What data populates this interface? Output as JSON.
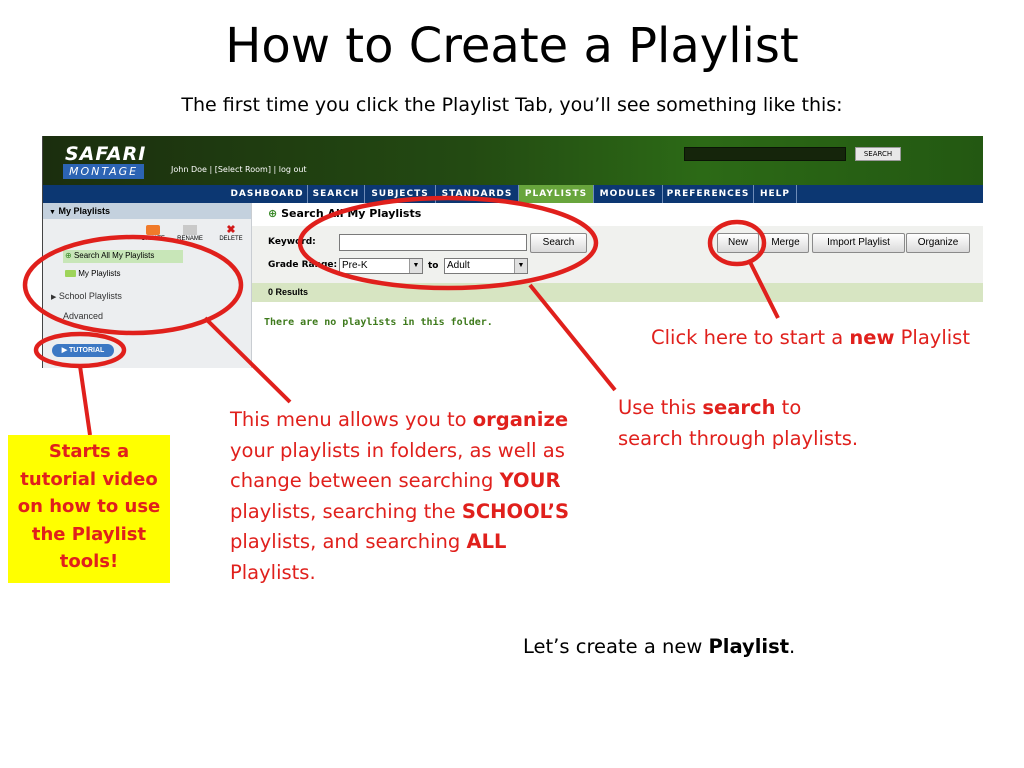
{
  "slide": {
    "title": "How to Create a Playlist",
    "subtitle": "The first time you click the Playlist Tab, you’ll see something like this:"
  },
  "app": {
    "logo_top": "SAFARI",
    "logo_bottom": "MONTAGE",
    "user_line": "John Doe | [Select Room] | log out",
    "global_search_button": "SEARCH",
    "nav": [
      {
        "label": "DASHBOARD",
        "active": false
      },
      {
        "label": "SEARCH",
        "active": false
      },
      {
        "label": "SUBJECTS",
        "active": false
      },
      {
        "label": "STANDARDS",
        "active": false
      },
      {
        "label": "PLAYLISTS",
        "active": true
      },
      {
        "label": "MODULES",
        "active": false
      },
      {
        "label": "PREFERENCES",
        "active": false
      },
      {
        "label": "HELP",
        "active": false
      }
    ],
    "sidebar": {
      "header": "My Playlists",
      "tools": [
        "CREATE",
        "RENAME",
        "DELETE"
      ],
      "tree": [
        "Search All My Playlists",
        "My Playlists"
      ],
      "sections": [
        "School Playlists",
        "Advanced"
      ],
      "tutorial_button": "TUTORIAL"
    },
    "main": {
      "title": "Search All My Playlists",
      "keyword_label": "Keyword:",
      "keyword_value": "",
      "search_button": "Search",
      "grade_label": "Grade Range:",
      "grade_from": "Pre-K",
      "grade_to_label": "to",
      "grade_to": "Adult",
      "buttons": [
        "New",
        "Merge",
        "Import Playlist",
        "Organize"
      ],
      "results_label": "0 Results",
      "empty_message": "There are no playlists in this folder."
    }
  },
  "annotations": {
    "new_note_pre": "Click here to start a ",
    "new_note_bold": "new",
    "new_note_post": " Playlist",
    "search_note_pre": "Use this ",
    "search_note_bold": "search",
    "search_note_post": " to",
    "search_note_line2": "search through playlists.",
    "menu_note": {
      "p1": "This menu allows you to ",
      "b1": "organize",
      "p2": "your playlists in folders, as well as change between searching ",
      "b2": "YOUR",
      "p3": "playlists, searching the ",
      "b3": "SCHOOL’S",
      "p4": "playlists, and searching ",
      "b4": "ALL",
      "p5": "Playlists."
    },
    "tutorial_note": "Starts a tutorial video on how to use the Playlist tools!",
    "closing_pre": "Let’s create a new ",
    "closing_bold": "Playlist",
    "closing_post": "."
  },
  "colors": {
    "annotation_red": "#e0201c",
    "highlight_yellow": "#ffff00",
    "nav_blue": "#0c3772",
    "nav_active_green": "#68a53c"
  }
}
